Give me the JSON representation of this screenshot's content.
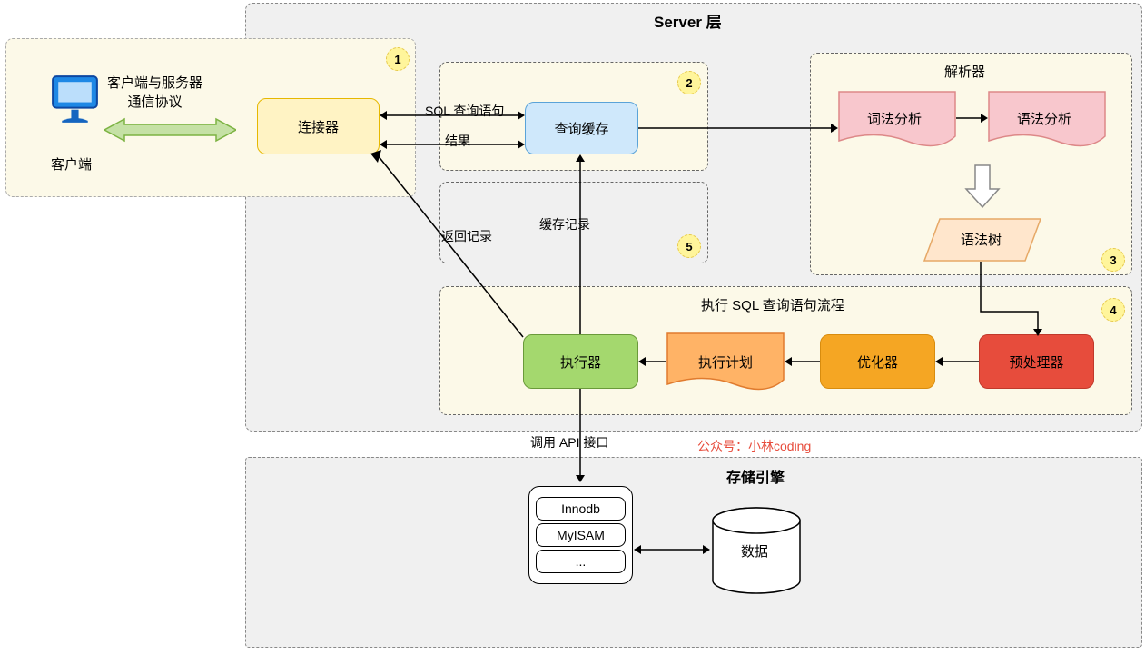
{
  "serverLayer": {
    "title": "Server 层"
  },
  "client": {
    "label": "客户端",
    "protocol": "客户端与服务器\n通信协议"
  },
  "group1": {
    "num": "1",
    "connector": "连接器"
  },
  "group2": {
    "num": "2",
    "cache": "查询缓存",
    "sqlLabel": "SQL 查询语句",
    "resultLabel": "结果"
  },
  "parser": {
    "title": "解析器",
    "lexical": "词法分析",
    "syntax": "语法分析",
    "tree": "语法树",
    "num": "3"
  },
  "group4": {
    "num": "4",
    "title": "执行 SQL 查询语句流程",
    "executor": "执行器",
    "plan": "执行计划",
    "optimizer": "优化器",
    "preprocessor": "预处理器"
  },
  "group5": {
    "num": "5",
    "cacheRecord": "缓存记录",
    "returnRecord": "返回记录"
  },
  "api": {
    "label": "调用 API 接口"
  },
  "credit": "公众号：小林coding",
  "storage": {
    "title": "存储引擎",
    "engines": [
      "Innodb",
      "MyISAM",
      "..."
    ],
    "data": "数据"
  }
}
